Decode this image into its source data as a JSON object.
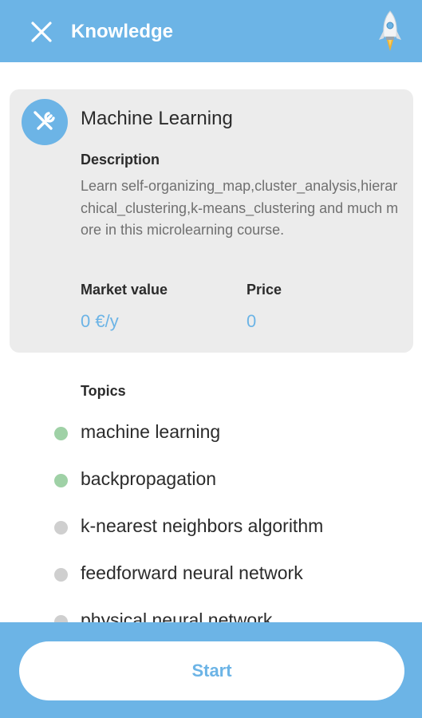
{
  "header": {
    "title": "Knowledge",
    "close_icon": "close-icon",
    "rocket_icon": "rocket-icon"
  },
  "course": {
    "icon": "tools-icon",
    "title": "Machine Learning",
    "description_heading": "Description",
    "description": "Learn self-organizing_map,cluster_analysis,hierarchical_clustering,k-means_clustering and much more in this microlearning course.",
    "market_value_label": "Market value",
    "market_value": "0 €/y",
    "price_label": "Price",
    "price": "0"
  },
  "topics": {
    "heading": "Topics",
    "items": [
      {
        "label": "machine learning",
        "status": "done"
      },
      {
        "label": "backpropagation",
        "status": "done"
      },
      {
        "label": "k-nearest neighbors algorithm",
        "status": "todo"
      },
      {
        "label": "feedforward neural network",
        "status": "todo"
      },
      {
        "label": "physical neural network",
        "status": "todo"
      }
    ]
  },
  "colors": {
    "primary": "#6cb4e6",
    "done_dot": "#9fd1a6",
    "todo_dot": "#cfcfcf",
    "card_bg": "#ececec"
  },
  "footer": {
    "start_label": "Start"
  }
}
